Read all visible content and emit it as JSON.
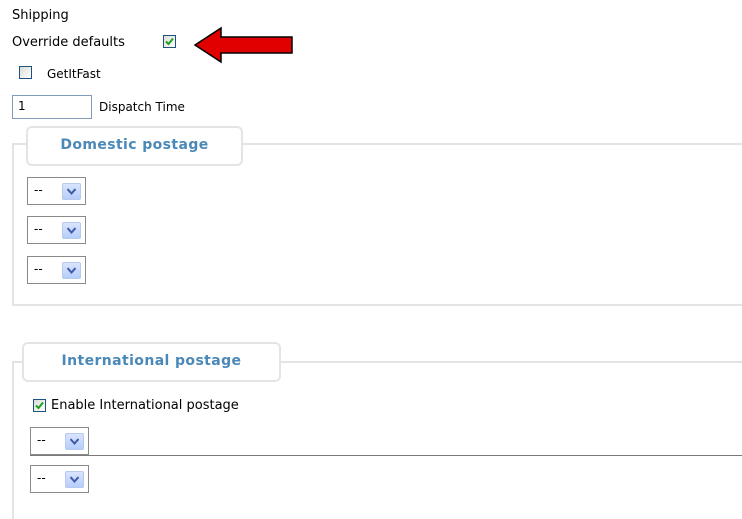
{
  "shipping": {
    "heading": "Shipping",
    "override_defaults_label": "Override defaults",
    "override_defaults_checked": true,
    "getitfast_label": "GetItFast",
    "getitfast_checked": false,
    "dispatch_time_value": "1",
    "dispatch_time_label": "Dispatch Time"
  },
  "domestic": {
    "legend": "Domestic postage",
    "selects": [
      "--",
      "--",
      "--"
    ]
  },
  "international": {
    "legend": "International postage",
    "enable_label": "Enable International postage",
    "enable_checked": true,
    "selects": [
      "--",
      "--"
    ]
  },
  "annotation": {
    "arrow_color": "#e00000"
  },
  "icons": {
    "checkmark": "checkmark-icon",
    "dropdown": "chevron-down-icon",
    "arrow": "arrow-left-icon"
  },
  "colors": {
    "legend_text": "#4a88b8",
    "checkmark": "#21a121",
    "select_button": "#c6d8fd",
    "frame_border": "#e4e4e4"
  }
}
